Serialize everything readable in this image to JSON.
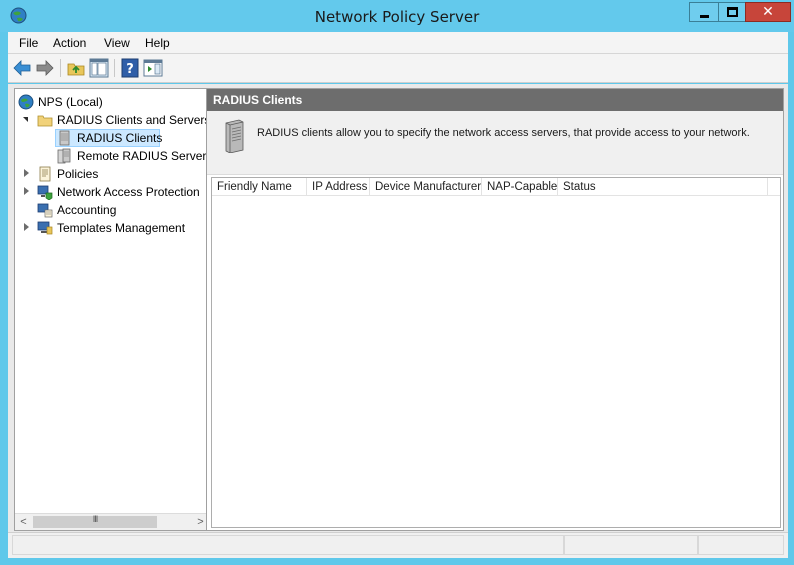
{
  "window": {
    "title": "Network Policy Server",
    "minimize_glyph": "",
    "close_glyph": "✕"
  },
  "menu": {
    "items": [
      "File",
      "Action",
      "View",
      "Help"
    ]
  },
  "toolbar": {
    "buttons": [
      "back-arrow-icon",
      "forward-arrow-icon",
      "up-folder-icon",
      "show-hide-console-tree-icon",
      "help-icon",
      "show-hide-action-pane-icon"
    ]
  },
  "tree": {
    "items": [
      {
        "label": "NPS (Local)",
        "icon": "nps-globe-icon"
      },
      {
        "label": "RADIUS Clients and Servers",
        "icon": "folder-icon"
      },
      {
        "label": "RADIUS Clients",
        "icon": "server-icon"
      },
      {
        "label": "Remote RADIUS Server",
        "icon": "server-group-icon"
      },
      {
        "label": "Policies",
        "icon": "policies-icon"
      },
      {
        "label": "Network Access Protection",
        "icon": "network-access-protection-icon"
      },
      {
        "label": "Accounting",
        "icon": "accounting-icon"
      },
      {
        "label": "Templates Management",
        "icon": "templates-icon"
      }
    ],
    "scroll_grip": "III",
    "scroll_left": "<",
    "scroll_right": ">"
  },
  "panel": {
    "header": "RADIUS Clients",
    "description": "RADIUS clients allow you to specify the network access servers, that provide access to your network.",
    "columns": [
      "Friendly Name",
      "IP Address",
      "Device Manufacturer",
      "NAP-Capable",
      "Status"
    ]
  },
  "colors": {
    "titlebar": "#63c9ec",
    "close_button": "#c7453a",
    "panel_header": "#6d6d6d",
    "selection": "#cce8ff"
  }
}
